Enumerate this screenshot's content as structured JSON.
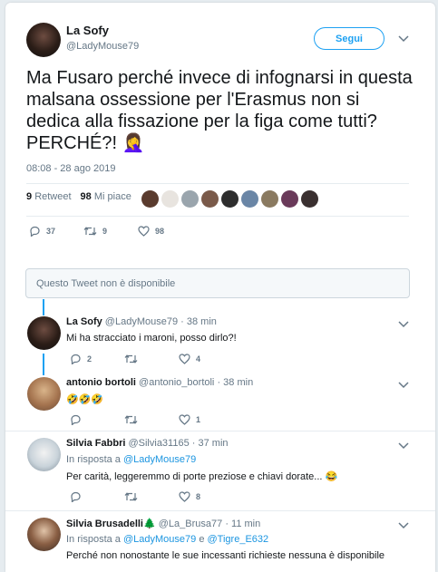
{
  "main": {
    "author_name": "La Sofy",
    "author_handle": "@LadyMouse79",
    "follow_label": "Segui",
    "text": "Ma Fusaro perché invece di infognarsi in questa malsana ossessione per l'Erasmus non si dedica alla fissazione per la figa come tutti? PERCHÉ?! 🤦‍♀️",
    "timestamp": "08:08 - 28 ago 2019",
    "retweet_count": "9",
    "retweet_label": "Retweet",
    "like_count": "98",
    "like_label": "Mi piace",
    "replies": "37",
    "retweets": "9",
    "likes": "98"
  },
  "likers": [
    "#5a3b2e",
    "#e8e4df",
    "#9aa5ad",
    "#7a5a4a",
    "#2e2e2e",
    "#6a86a6",
    "#8a7a60",
    "#6a3a5a",
    "#3a3030"
  ],
  "unavailable_text": "Questo Tweet non è disponibile",
  "replies": [
    {
      "name": "La Sofy",
      "handle": "@LadyMouse79",
      "time": "· 38 min",
      "text": "Mi ha stracciato i maroni, posso dirlo?!",
      "replies": "2",
      "retweets": "",
      "likes": "4"
    },
    {
      "name": "antonio bortoli",
      "handle": "@antonio_bortoli",
      "time": "· 38 min",
      "text": "🤣🤣🤣",
      "replies": "",
      "retweets": "",
      "likes": "1"
    },
    {
      "name": "Silvia Fabbri",
      "handle": "@Silvia31165",
      "time": "· 37 min",
      "reply_to_prefix": "In risposta a",
      "reply_to_1": "@LadyMouse79",
      "text": "Per carità, leggeremmo di porte preziose e chiavi dorate... 😂",
      "replies": "",
      "retweets": "",
      "likes": "8"
    },
    {
      "name": "Silvia Brusadelli🌲",
      "handle": "@La_Brusa77",
      "time": "· 11 min",
      "reply_to_prefix": "In risposta a",
      "reply_to_1": "@LadyMouse79",
      "reply_to_and": "e",
      "reply_to_2": "@Tigre_E632",
      "text": "Perché non nonostante le sue incessanti richieste nessuna è disponibile"
    }
  ]
}
